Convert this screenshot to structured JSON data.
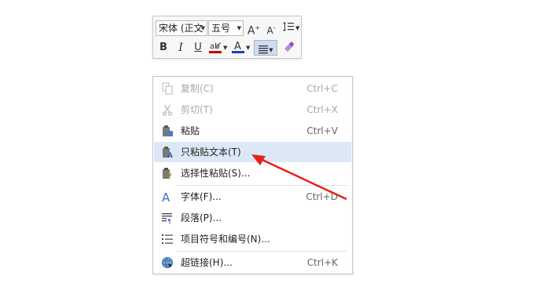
{
  "toolbar": {
    "font_name": "宋体 (正文",
    "font_size": "五号",
    "grow_font_glyph": "A",
    "shrink_font_glyph": "A",
    "bold_glyph": "B",
    "italic_glyph": "I",
    "underline_glyph": "U",
    "font_color_glyph": "A",
    "highlight_color": "#c00000",
    "font_color": "#1f3fbf"
  },
  "context_menu": {
    "items": [
      {
        "label": "复制(C)",
        "shortcut": "Ctrl+C",
        "icon": "copy-icon",
        "enabled": false
      },
      {
        "label": "剪切(T)",
        "shortcut": "Ctrl+X",
        "icon": "cut-icon",
        "enabled": false
      },
      {
        "label": "粘贴",
        "shortcut": "Ctrl+V",
        "icon": "paste-icon",
        "enabled": true
      },
      {
        "label": "只粘贴文本(T)",
        "shortcut": "",
        "icon": "paste-text-only-icon",
        "enabled": true,
        "highlighted": true
      },
      {
        "label": "选择性粘贴(S)...",
        "shortcut": "",
        "icon": "paste-special-icon",
        "enabled": true
      },
      {
        "label": "字体(F)...",
        "shortcut": "Ctrl+D",
        "icon": "font-icon",
        "enabled": true
      },
      {
        "label": "段落(P)...",
        "shortcut": "",
        "icon": "paragraph-icon",
        "enabled": true
      },
      {
        "label": "项目符号和编号(N)...",
        "shortcut": "",
        "icon": "bullets-numbering-icon",
        "enabled": true
      },
      {
        "label": "超链接(H)...",
        "shortcut": "Ctrl+K",
        "icon": "hyperlink-icon",
        "enabled": true
      }
    ]
  },
  "annotation": {
    "arrow_color": "#e8201a"
  }
}
